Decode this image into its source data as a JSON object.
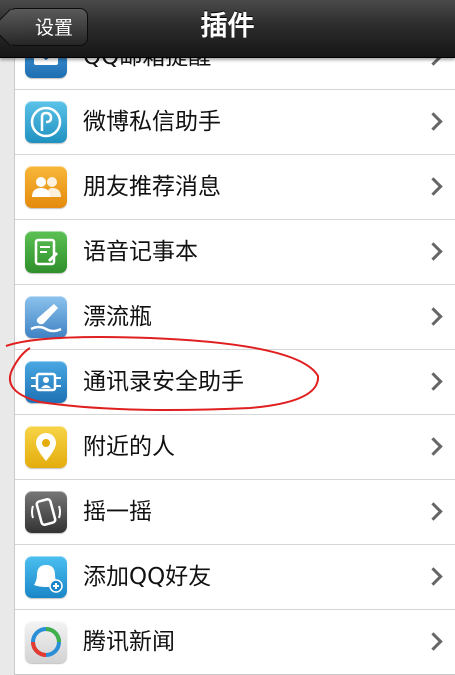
{
  "navbar": {
    "back_label": "设置",
    "title": "插件"
  },
  "items": [
    {
      "label": "QQ邮箱提醒",
      "icon": "mail-icon",
      "color": "#2f86c9"
    },
    {
      "label": "微博私信助手",
      "icon": "weibo-icon",
      "color": "#32a8d4"
    },
    {
      "label": "朋友推荐消息",
      "icon": "friends-icon",
      "color": "#f2a11a"
    },
    {
      "label": "语音记事本",
      "icon": "notepad-icon",
      "color": "#3ea83a"
    },
    {
      "label": "漂流瓶",
      "icon": "bottle-icon",
      "color": "#5a9fd6"
    },
    {
      "label": "通讯录安全助手",
      "icon": "contacts-sync-icon",
      "color": "#2b8fd1"
    },
    {
      "label": "附近的人",
      "icon": "location-pin-icon",
      "color": "#f0c41c"
    },
    {
      "label": "摇一摇",
      "icon": "shake-phone-icon",
      "color": "#555555"
    },
    {
      "label": "添加QQ好友",
      "icon": "qq-add-friend-icon",
      "color": "#2aa4e0"
    },
    {
      "label": "腾讯新闻",
      "icon": "tencent-news-icon",
      "color": "#e8e8e8"
    }
  ]
}
